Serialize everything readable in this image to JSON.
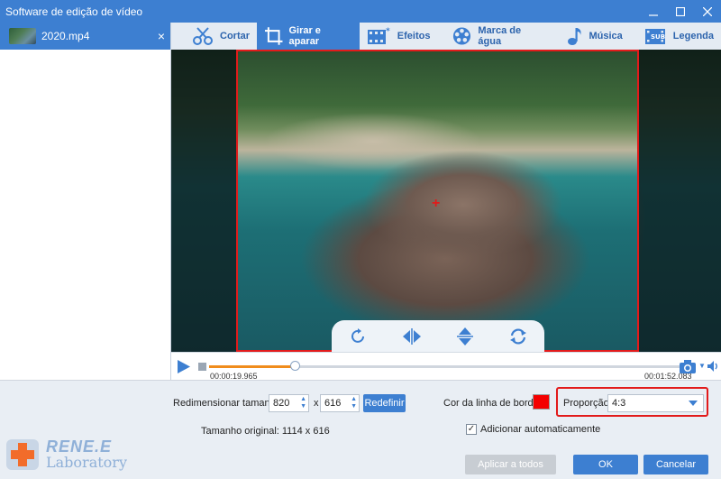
{
  "window": {
    "title": "Software de edição de vídeo",
    "minimize_icon": "minimize-icon",
    "maximize_icon": "maximize-icon",
    "close_icon": "close-icon"
  },
  "file_list": {
    "items": [
      {
        "name": "2020.mp4",
        "close": "×"
      }
    ]
  },
  "toolbar": {
    "tabs": [
      {
        "label": "Cortar",
        "icon": "scissors-icon"
      },
      {
        "label": "Girar e aparar",
        "icon": "crop-icon",
        "active": true
      },
      {
        "label": "Efeitos",
        "icon": "film-effects-icon"
      },
      {
        "label": "Marca de água",
        "icon": "film-reel-icon"
      },
      {
        "label": "Música",
        "icon": "music-note-icon"
      },
      {
        "label": "Legenda",
        "icon": "subtitle-icon"
      }
    ]
  },
  "preview": {
    "crosshair": "+",
    "collapse": "⌄",
    "tools": [
      "rotate-icon",
      "flip-horizontal-icon",
      "flip-vertical-icon",
      "reset-rotation-icon"
    ]
  },
  "player": {
    "current_time": "00:00:19.965",
    "total_time": "00:01:52.083",
    "progress_fraction": 0.18
  },
  "controls": {
    "resize_label": "Redimensionar tamanho:",
    "width_value": "820",
    "times_symbol": "x",
    "height_value": "616",
    "reset_button": "Redefinir",
    "original_size_label": "Tamanho original: 1114 x 616",
    "border_color_label": "Cor da linha de borda:",
    "border_color": "#f40000",
    "ratio_label": "Proporção:",
    "ratio_value": "4:3",
    "auto_add_label": "Adicionar automaticamente",
    "auto_add_checked": "✓",
    "apply_all_button": "Aplicar a todos",
    "ok_button": "OK",
    "cancel_button": "Cancelar"
  },
  "logo": {
    "line1": "RENE.E",
    "line2": "Laboratory"
  },
  "colors": {
    "accent": "#3d7fd1",
    "highlight": "#e21b1b",
    "progress": "#f08c1c"
  }
}
